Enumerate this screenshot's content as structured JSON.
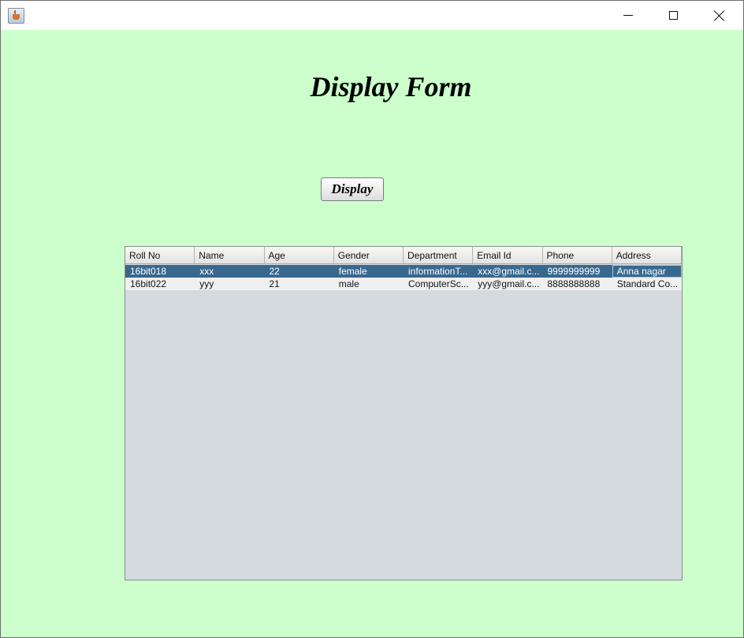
{
  "window": {
    "minimize": "minimize",
    "maximize": "maximize",
    "close": "close"
  },
  "heading": "Display Form",
  "display_button": "Display",
  "table": {
    "columns": [
      "Roll No",
      "Name",
      "Age",
      "Gender",
      "Department",
      "Email Id",
      "Phone",
      "Address"
    ],
    "rows": [
      [
        "16bit018",
        "xxx",
        "22",
        "female",
        "informationT...",
        "xxx@gmail.c...",
        "9999999999",
        "Anna nagar"
      ],
      [
        "16bit022",
        "yyy",
        "21",
        "male",
        "ComputerSc...",
        "yyy@gmail.c...",
        "8888888888",
        "Standard Co..."
      ]
    ],
    "selected_row": 0
  },
  "colors": {
    "background": "#ccffcc",
    "selection": "#39688f",
    "table_empty": "#d5d9e0"
  }
}
